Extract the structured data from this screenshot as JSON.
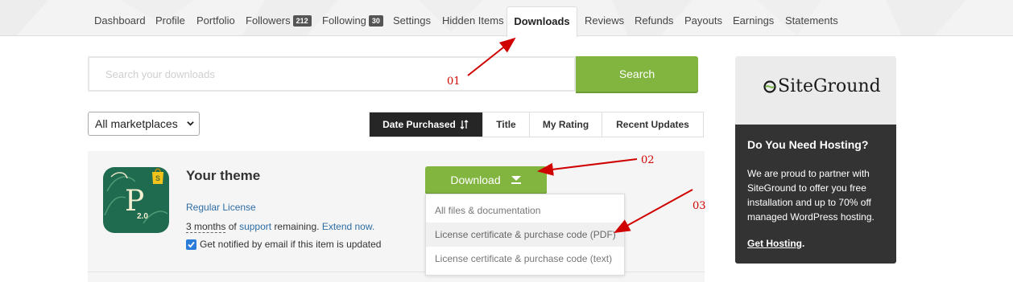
{
  "nav": {
    "items": [
      {
        "label": "Dashboard"
      },
      {
        "label": "Profile"
      },
      {
        "label": "Portfolio"
      },
      {
        "label": "Followers",
        "badge": "212"
      },
      {
        "label": "Following",
        "badge": "30"
      },
      {
        "label": "Settings"
      },
      {
        "label": "Hidden Items"
      },
      {
        "label": "Downloads",
        "active": true
      },
      {
        "label": "Reviews"
      },
      {
        "label": "Refunds"
      },
      {
        "label": "Payouts"
      },
      {
        "label": "Earnings"
      },
      {
        "label": "Statements"
      }
    ]
  },
  "search": {
    "placeholder": "Search your downloads",
    "button_label": "Search"
  },
  "filter": {
    "marketplace_selected": "All marketplaces"
  },
  "sort": {
    "options": [
      "Date Purchased",
      "Title",
      "My Rating",
      "Recent Updates"
    ],
    "active_icon": "sort-arrows-icon"
  },
  "item": {
    "title": "Your theme",
    "thumb_text": "P",
    "thumb_version": "2.0",
    "license": "Regular License",
    "support_months": "3 months",
    "support_of": "of",
    "support_link": "support",
    "support_remaining": "remaining.",
    "extend_link": "Extend now.",
    "notify_label": "Get notified by email if this item is updated",
    "notify_checked": true
  },
  "download": {
    "button_label": "Download",
    "menu": [
      "All files & documentation",
      "License certificate & purchase code (PDF)",
      "License certificate & purchase code (text)"
    ]
  },
  "annotations": {
    "a1": "01",
    "a2": "02",
    "a3": "03",
    "color": "#d00000"
  },
  "ad": {
    "logo_text": "SiteGround",
    "heading": "Do You Need Hosting?",
    "body": "We are proud to partner with SiteGround to offer you free installation and up to 70% off managed WordPress hosting.",
    "link": "Get Hosting",
    "link_suffix": "."
  },
  "colors": {
    "accent_green": "#82b440",
    "link_blue": "#2e6da4",
    "dark": "#333333"
  }
}
